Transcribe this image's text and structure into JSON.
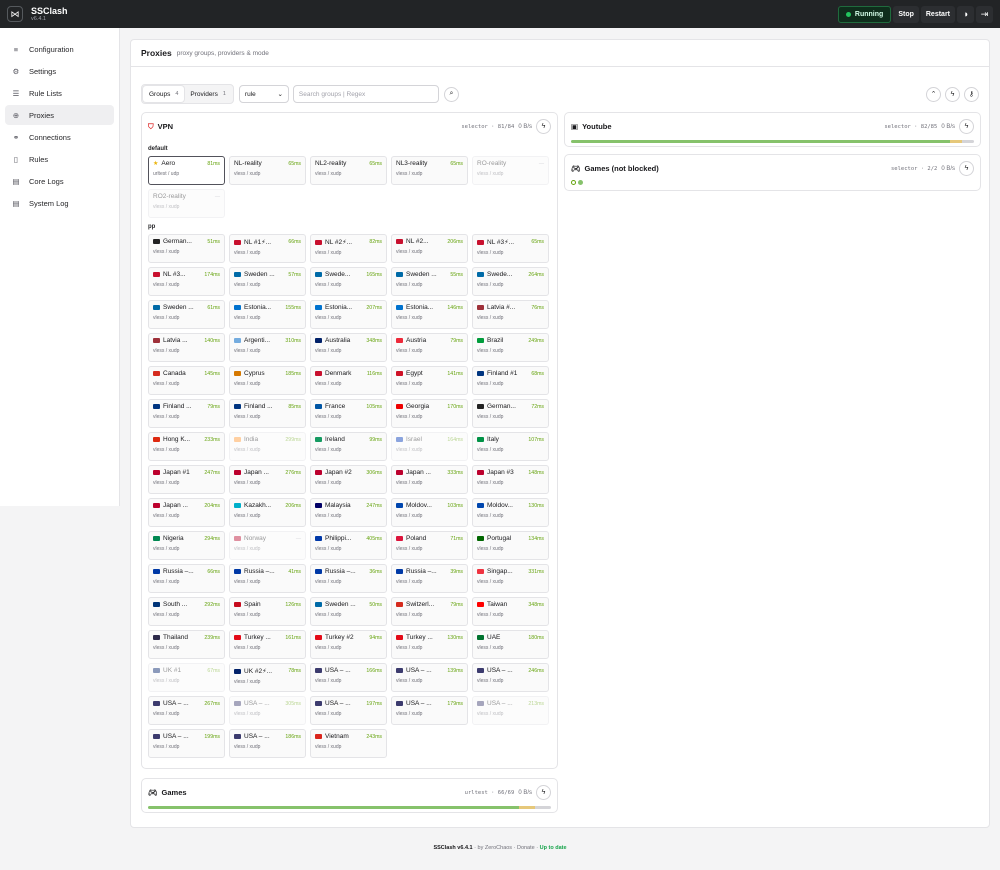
{
  "app": {
    "title": "SSClash",
    "version": "v6.4.1"
  },
  "topbar": {
    "status": "Running",
    "stop": "Stop",
    "restart": "Restart"
  },
  "nav": [
    {
      "label": "Configuration",
      "icon": "menu-icon",
      "glyph": "≡"
    },
    {
      "label": "Settings",
      "icon": "gear-icon",
      "glyph": "⚙"
    },
    {
      "label": "Rule Lists",
      "icon": "list-icon",
      "glyph": "☰"
    },
    {
      "label": "Proxies",
      "icon": "globe-icon",
      "glyph": "⊕",
      "active": true
    },
    {
      "label": "Connections",
      "icon": "link-icon",
      "glyph": "⚭"
    },
    {
      "label": "Rules",
      "icon": "book-icon",
      "glyph": "▯"
    },
    {
      "label": "Core Logs",
      "icon": "file-icon",
      "glyph": "▤"
    },
    {
      "label": "System Log",
      "icon": "file-text-icon",
      "glyph": "▤"
    }
  ],
  "page": {
    "title": "Proxies",
    "subtitle": "proxy groups, providers & mode"
  },
  "toolbar": {
    "groups_label": "Groups",
    "groups_count": "4",
    "providers_label": "Providers",
    "providers_count": "1",
    "mode": "rule",
    "search_placeholder": "Search groups | Regex"
  },
  "groups": {
    "vpn": {
      "name": "VPN",
      "meta": "selector · 81/84",
      "rate": "0 B/s",
      "sections": [
        {
          "title": "default",
          "items": [
            {
              "name": "Aero",
              "latency": "81ms",
              "type": "urltest / udp",
              "active": true,
              "star": true
            },
            {
              "name": "NL-reality",
              "latency": "65ms",
              "type": "vless / xudp"
            },
            {
              "name": "NL2-reality",
              "latency": "65ms",
              "type": "vless / xudp"
            },
            {
              "name": "NL3-reality",
              "latency": "65ms",
              "type": "vless / xudp"
            },
            {
              "name": "RO-reality",
              "latency": "—",
              "type": "vless / xudp",
              "dim": true
            },
            {
              "name": "RO2-reality",
              "latency": "—",
              "type": "vless / xudp",
              "dim": true
            }
          ]
        },
        {
          "title": "pp",
          "items": [
            {
              "name": "German...",
              "flag": "DE",
              "latency": "51ms",
              "type": "vless / xudp"
            },
            {
              "name": "NL #1⚡...",
              "flag": "NL",
              "latency": "66ms",
              "type": "vless / xudp"
            },
            {
              "name": "NL #2⚡...",
              "flag": "NL",
              "latency": "82ms",
              "type": "vless / xudp"
            },
            {
              "name": "NL #2...",
              "flag": "NL",
              "latency": "206ms",
              "type": "vless / xudp"
            },
            {
              "name": "NL #3⚡...",
              "flag": "NL",
              "latency": "65ms",
              "type": "vless / xudp"
            },
            {
              "name": "NL #3...",
              "flag": "NL",
              "latency": "174ms",
              "type": "vless / xudp"
            },
            {
              "name": "Sweden ...",
              "flag": "SE",
              "latency": "57ms",
              "type": "vless / xudp"
            },
            {
              "name": "Swede...",
              "flag": "SE",
              "latency": "165ms",
              "type": "vless / xudp"
            },
            {
              "name": "Sweden ...",
              "flag": "SE",
              "latency": "55ms",
              "type": "vless / xudp"
            },
            {
              "name": "Swede...",
              "flag": "SE",
              "latency": "264ms",
              "type": "vless / xudp"
            },
            {
              "name": "Sweden ...",
              "flag": "SE",
              "latency": "61ms",
              "type": "vless / xudp"
            },
            {
              "name": "Estonia...",
              "flag": "EE",
              "latency": "155ms",
              "type": "vless / xudp"
            },
            {
              "name": "Estonia...",
              "flag": "EE",
              "latency": "207ms",
              "type": "vless / xudp"
            },
            {
              "name": "Estonia...",
              "flag": "EE",
              "latency": "146ms",
              "type": "vless / xudp"
            },
            {
              "name": "Latvia #...",
              "flag": "LV",
              "latency": "76ms",
              "type": "vless / xudp"
            },
            {
              "name": "Latvia ...",
              "flag": "LV",
              "latency": "140ms",
              "type": "vless / xudp"
            },
            {
              "name": "Argenti...",
              "flag": "AR",
              "latency": "310ms",
              "type": "vless / xudp"
            },
            {
              "name": "Australia",
              "flag": "AU",
              "latency": "348ms",
              "type": "vless / xudp"
            },
            {
              "name": "Austria",
              "flag": "AT",
              "latency": "79ms",
              "type": "vless / xudp"
            },
            {
              "name": "Brazil",
              "flag": "BR",
              "latency": "249ms",
              "type": "vless / xudp"
            },
            {
              "name": "Canada",
              "flag": "CA",
              "latency": "145ms",
              "type": "vless / xudp"
            },
            {
              "name": "Cyprus",
              "flag": "CY",
              "latency": "185ms",
              "type": "vless / xudp"
            },
            {
              "name": "Denmark",
              "flag": "DK",
              "latency": "116ms",
              "type": "vless / xudp"
            },
            {
              "name": "Egypt",
              "flag": "EG",
              "latency": "141ms",
              "type": "vless / xudp"
            },
            {
              "name": "Finland #1",
              "flag": "FI",
              "latency": "68ms",
              "type": "vless / xudp"
            },
            {
              "name": "Finland ...",
              "flag": "FI",
              "latency": "79ms",
              "type": "vless / xudp"
            },
            {
              "name": "Finland ...",
              "flag": "FI",
              "latency": "85ms",
              "type": "vless / xudp"
            },
            {
              "name": "France",
              "flag": "FR",
              "latency": "105ms",
              "type": "vless / xudp"
            },
            {
              "name": "Georgia",
              "flag": "GE",
              "latency": "170ms",
              "type": "vless / xudp"
            },
            {
              "name": "German...",
              "flag": "DE",
              "latency": "72ms",
              "type": "vless / xudp"
            },
            {
              "name": "Hong K...",
              "flag": "HK",
              "latency": "233ms",
              "type": "vless / xudp"
            },
            {
              "name": "India",
              "flag": "IN",
              "latency": "299ms",
              "type": "vless / xudp",
              "dim": true
            },
            {
              "name": "Ireland",
              "flag": "IE",
              "latency": "99ms",
              "type": "vless / xudp"
            },
            {
              "name": "Israel",
              "flag": "IL",
              "latency": "164ms",
              "type": "vless / xudp",
              "dim": true
            },
            {
              "name": "Italy",
              "flag": "IT",
              "latency": "107ms",
              "type": "vless / xudp"
            },
            {
              "name": "Japan #1",
              "flag": "JP",
              "latency": "247ms",
              "type": "vless / xudp"
            },
            {
              "name": "Japan ...",
              "flag": "JP",
              "latency": "276ms",
              "type": "vless / xudp"
            },
            {
              "name": "Japan #2",
              "flag": "JP",
              "latency": "306ms",
              "type": "vless / xudp"
            },
            {
              "name": "Japan ...",
              "flag": "JP",
              "latency": "333ms",
              "type": "vless / xudp"
            },
            {
              "name": "Japan #3",
              "flag": "JP",
              "latency": "148ms",
              "type": "vless / xudp"
            },
            {
              "name": "Japan ...",
              "flag": "JP",
              "latency": "204ms",
              "type": "vless / xudp"
            },
            {
              "name": "Kazakh...",
              "flag": "KZ",
              "latency": "206ms",
              "type": "vless / xudp"
            },
            {
              "name": "Malaysia",
              "flag": "MY",
              "latency": "247ms",
              "type": "vless / xudp"
            },
            {
              "name": "Moldov...",
              "flag": "MD",
              "latency": "103ms",
              "type": "vless / xudp"
            },
            {
              "name": "Moldov...",
              "flag": "MD",
              "latency": "130ms",
              "type": "vless / xudp"
            },
            {
              "name": "Nigeria",
              "flag": "NG",
              "latency": "294ms",
              "type": "vless / xudp"
            },
            {
              "name": "Norway",
              "flag": "NO",
              "latency": "—",
              "type": "vless / xudp",
              "dim": true
            },
            {
              "name": "Philippi...",
              "flag": "PH",
              "latency": "405ms",
              "type": "vless / xudp"
            },
            {
              "name": "Poland",
              "flag": "PL",
              "latency": "71ms",
              "type": "vless / xudp"
            },
            {
              "name": "Portugal",
              "flag": "PT",
              "latency": "134ms",
              "type": "vless / xudp"
            },
            {
              "name": "Russia –...",
              "flag": "RU",
              "latency": "66ms",
              "type": "vless / xudp"
            },
            {
              "name": "Russia –...",
              "flag": "RU",
              "latency": "41ms",
              "type": "vless / xudp"
            },
            {
              "name": "Russia –...",
              "flag": "RU",
              "latency": "36ms",
              "type": "vless / xudp"
            },
            {
              "name": "Russia –...",
              "flag": "RU",
              "latency": "39ms",
              "type": "vless / xudp"
            },
            {
              "name": "Singap...",
              "flag": "SG",
              "latency": "331ms",
              "type": "vless / xudp"
            },
            {
              "name": "South ...",
              "flag": "KR",
              "latency": "292ms",
              "type": "vless / xudp"
            },
            {
              "name": "Spain",
              "flag": "ES",
              "latency": "126ms",
              "type": "vless / xudp"
            },
            {
              "name": "Sweden ...",
              "flag": "SE",
              "latency": "50ms",
              "type": "vless / xudp"
            },
            {
              "name": "Switzerl...",
              "flag": "CH",
              "latency": "79ms",
              "type": "vless / xudp"
            },
            {
              "name": "Taiwan",
              "flag": "TW",
              "latency": "348ms",
              "type": "vless / xudp"
            },
            {
              "name": "Thailand",
              "flag": "TH",
              "latency": "239ms",
              "type": "vless / xudp"
            },
            {
              "name": "Turkey ...",
              "flag": "TR",
              "latency": "161ms",
              "type": "vless / xudp"
            },
            {
              "name": "Turkey #2",
              "flag": "TR",
              "latency": "94ms",
              "type": "vless / xudp"
            },
            {
              "name": "Turkey ...",
              "flag": "TR",
              "latency": "130ms",
              "type": "vless / xudp"
            },
            {
              "name": "UAE",
              "flag": "AE",
              "latency": "180ms",
              "type": "vless / xudp"
            },
            {
              "name": "UK #1",
              "flag": "GB",
              "latency": "67ms",
              "type": "vless / xudp",
              "dim": true
            },
            {
              "name": "UK #2⚡...",
              "flag": "GB",
              "latency": "78ms",
              "type": "vless / xudp"
            },
            {
              "name": "USA – ...",
              "flag": "US",
              "latency": "166ms",
              "type": "vless / xudp"
            },
            {
              "name": "USA – ...",
              "flag": "US",
              "latency": "139ms",
              "type": "vless / xudp"
            },
            {
              "name": "USA – ...",
              "flag": "US",
              "latency": "246ms",
              "type": "vless / xudp"
            },
            {
              "name": "USA – ...",
              "flag": "US",
              "latency": "267ms",
              "type": "vless / xudp"
            },
            {
              "name": "USA – ...",
              "flag": "US",
              "latency": "305ms",
              "type": "vless / xudp",
              "dim": true
            },
            {
              "name": "USA – ...",
              "flag": "US",
              "latency": "197ms",
              "type": "vless / xudp"
            },
            {
              "name": "USA – ...",
              "flag": "US",
              "latency": "179ms",
              "type": "vless / xudp"
            },
            {
              "name": "USA – ...",
              "flag": "US",
              "latency": "213ms",
              "type": "vless / xudp",
              "dim": true
            },
            {
              "name": "USA – ...",
              "flag": "US",
              "latency": "199ms",
              "type": "vless / xudp"
            },
            {
              "name": "USA – ...",
              "flag": "US",
              "latency": "186ms",
              "type": "vless / xudp"
            },
            {
              "name": "Vietnam",
              "flag": "VN",
              "latency": "243ms",
              "type": "vless / xudp"
            }
          ]
        }
      ]
    },
    "youtube": {
      "name": "Youtube",
      "meta": "selector · 82/85",
      "rate": "0 B/s"
    },
    "games_nb": {
      "name": "Games (not blocked)",
      "meta": "selector · 2/2",
      "rate": "0 B/s"
    },
    "games": {
      "name": "Games",
      "meta": "urltest · 66/69",
      "rate": "0 B/s"
    }
  },
  "footer": {
    "app": "SSClash v6.4.1",
    "by": "by ZeroChaos",
    "donate": "Donate",
    "status": "Up to date"
  },
  "colors": {
    "accent": "#22c55e",
    "latency": "#65a30d",
    "topbar": "#222426"
  }
}
